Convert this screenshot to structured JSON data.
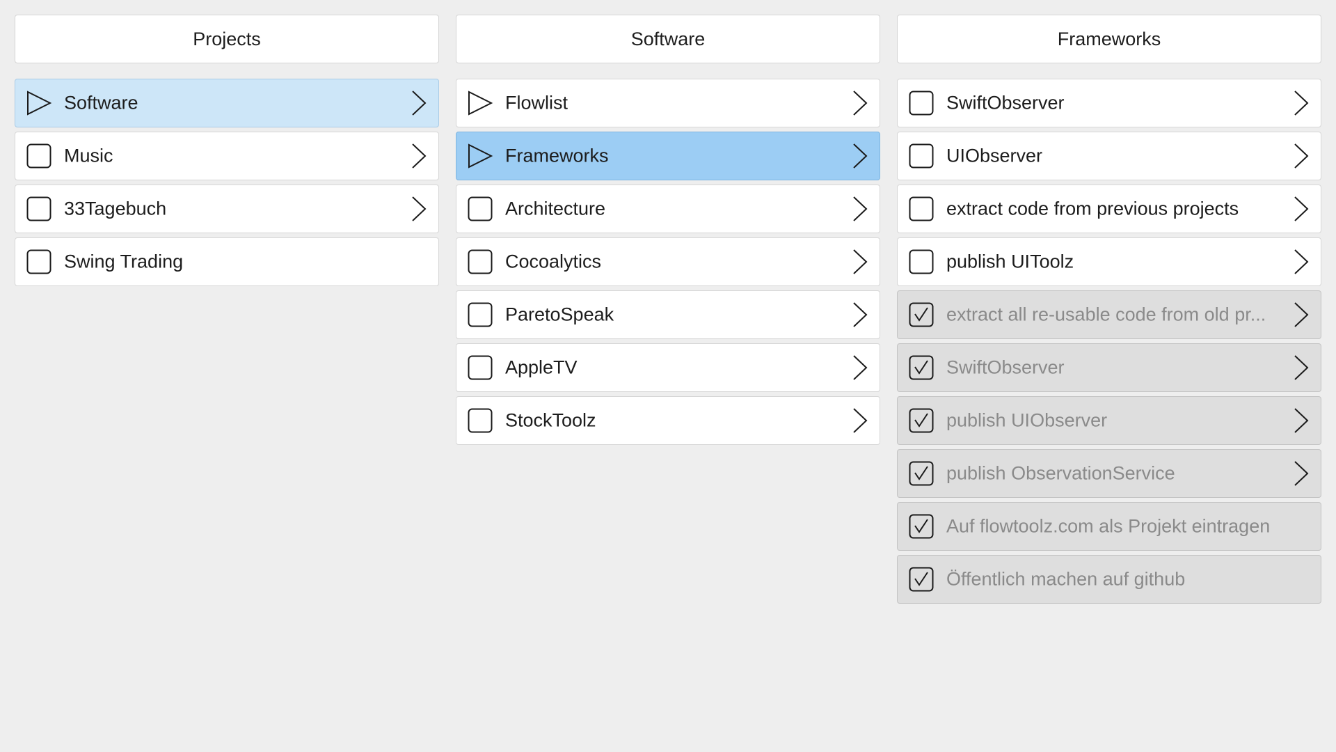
{
  "columns": [
    {
      "title": "Projects",
      "items": [
        {
          "label": "Software",
          "icon": "play-icon",
          "state": "selected-light",
          "chevron": true
        },
        {
          "label": "Music",
          "icon": "checkbox-icon",
          "state": "normal",
          "chevron": true
        },
        {
          "label": "33Tagebuch",
          "icon": "checkbox-icon",
          "state": "normal",
          "chevron": true
        },
        {
          "label": "Swing Trading",
          "icon": "checkbox-icon",
          "state": "normal",
          "chevron": false
        }
      ]
    },
    {
      "title": "Software",
      "items": [
        {
          "label": "Flowlist",
          "icon": "play-icon",
          "state": "normal",
          "chevron": true
        },
        {
          "label": "Frameworks",
          "icon": "play-icon",
          "state": "selected",
          "chevron": true
        },
        {
          "label": "Architecture",
          "icon": "checkbox-icon",
          "state": "normal",
          "chevron": true
        },
        {
          "label": "Cocoalytics",
          "icon": "checkbox-icon",
          "state": "normal",
          "chevron": true
        },
        {
          "label": "ParetoSpeak",
          "icon": "checkbox-icon",
          "state": "normal",
          "chevron": true
        },
        {
          "label": "AppleTV",
          "icon": "checkbox-icon",
          "state": "normal",
          "chevron": true
        },
        {
          "label": "StockToolz",
          "icon": "checkbox-icon",
          "state": "normal",
          "chevron": true
        }
      ]
    },
    {
      "title": "Frameworks",
      "items": [
        {
          "label": "SwiftObserver",
          "icon": "checkbox-icon",
          "state": "normal",
          "chevron": true
        },
        {
          "label": "UIObserver",
          "icon": "checkbox-icon",
          "state": "normal",
          "chevron": true
        },
        {
          "label": "extract code from previous projects",
          "icon": "checkbox-icon",
          "state": "normal",
          "chevron": true
        },
        {
          "label": "publish UIToolz",
          "icon": "checkbox-icon",
          "state": "normal",
          "chevron": true
        },
        {
          "label": "extract all re-usable code from old pr...",
          "icon": "checked-checkbox-icon",
          "state": "done",
          "chevron": true
        },
        {
          "label": "SwiftObserver",
          "icon": "checked-checkbox-icon",
          "state": "done",
          "chevron": true
        },
        {
          "label": "publish UIObserver",
          "icon": "checked-checkbox-icon",
          "state": "done",
          "chevron": true
        },
        {
          "label": "publish ObservationService",
          "icon": "checked-checkbox-icon",
          "state": "done",
          "chevron": true
        },
        {
          "label": "Auf flowtoolz.com als Projekt eintragen",
          "icon": "checked-checkbox-icon",
          "state": "done",
          "chevron": false
        },
        {
          "label": "Öffentlich machen auf github",
          "icon": "checked-checkbox-icon",
          "state": "done",
          "chevron": false
        }
      ]
    }
  ],
  "colors": {
    "background": "#eeeeee",
    "selected": "#9ccdf4",
    "selected_light": "#cde6f8",
    "done": "#dedede"
  }
}
